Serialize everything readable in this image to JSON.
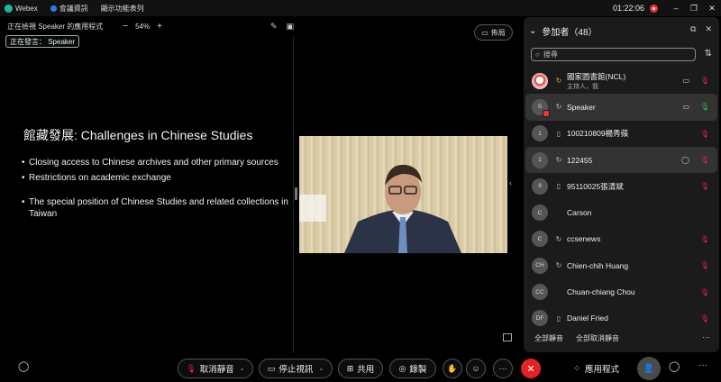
{
  "titlebar": {
    "app_name": "Webex",
    "meeting_info": "會議資訊",
    "menu_bar": "顯示功能表列",
    "time": "01:22:06",
    "win_minimize": "–",
    "win_restore": "❐",
    "win_close": "✕"
  },
  "viewbar": {
    "viewing_text": "正在檢視 Speaker 的應用程式",
    "zoom_out": "−",
    "zoom_level": "54%",
    "zoom_in": "+"
  },
  "speaking_label": "正在發言： Speaker",
  "layout_button": "佈局",
  "slide": {
    "title": "館藏發展: Challenges in Chinese Studies",
    "bullets": [
      "Closing access to Chinese archives and other primary sources",
      "Restrictions on academic exchange",
      "The special position of Chinese Studies and related collections in Taiwan"
    ]
  },
  "panel": {
    "title": "參加者（48）",
    "search_placeholder": "搜尋",
    "participants": [
      {
        "name": "國家圖書館(NCL)",
        "sub": "主持人，我",
        "avatar": "",
        "mic": "muted"
      },
      {
        "name": "Speaker",
        "sub": "",
        "avatar": "S",
        "mic": "on"
      },
      {
        "name": "100210809楊秀蘋",
        "sub": "",
        "avatar": "1",
        "mic": "muted"
      },
      {
        "name": "122455",
        "sub": "",
        "avatar": "1",
        "mic": "muted"
      },
      {
        "name": "95110025張清斌",
        "sub": "",
        "avatar": "9",
        "mic": "muted"
      },
      {
        "name": "Carson",
        "sub": "",
        "avatar": "C",
        "mic": ""
      },
      {
        "name": "ccsenews",
        "sub": "",
        "avatar": "C",
        "mic": "muted"
      },
      {
        "name": "Chien-chih Huang",
        "sub": "",
        "avatar": "CH",
        "mic": "muted"
      },
      {
        "name": "Chuan-chiang Chou",
        "sub": "",
        "avatar": "CC",
        "mic": "muted"
      },
      {
        "name": "Daniel Fried",
        "sub": "",
        "avatar": "DF",
        "mic": "muted"
      }
    ],
    "mute_all": "全部靜音",
    "unmute_all": "全部取消靜音",
    "more": "···"
  },
  "controls": {
    "unmute": "取消靜音",
    "stop_video": "停止視訊",
    "share": "共用",
    "record": "錄製",
    "more": "···",
    "end": "✕",
    "apps": "應用程式"
  },
  "colors": {
    "end_red": "#e02424",
    "mic_muted": "#e22244",
    "mic_on": "#2bbf5b",
    "host_icon": "#e3a43b"
  }
}
